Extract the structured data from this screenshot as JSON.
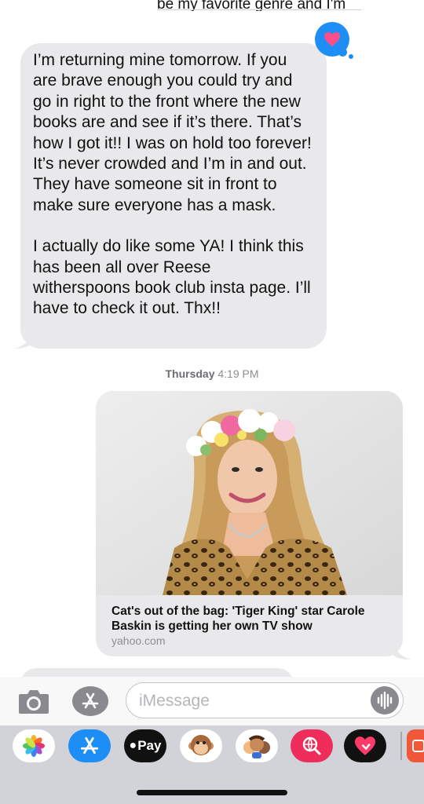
{
  "thread": {
    "previous_fragment": "be my favorite genre and I'm going",
    "incoming_message": {
      "paragraph1": "I’m returning mine tomorrow. If you are brave enough you could try and go in right to the front where the new books are and see if it’s there. That’s how I got it!! I was on hold too forever! It’s never crowded and I’m in and out. They have someone sit in front to make sure everyone has a mask.",
      "paragraph2": "I actually do like some YA! I think this has been all over  Reese witherspoons book club insta page. I’ll have to check it out. Thx!!"
    },
    "tapback": "heart-icon",
    "timestamp_day": "Thursday",
    "timestamp_time": "4:19 PM",
    "link_preview": {
      "title": "Cat's out of the bag: 'Tiger King' star Carole Baskin is getting her own TV show",
      "domain": "yahoo.com"
    }
  },
  "input_bar": {
    "placeholder": "iMessage"
  },
  "app_strip": {
    "items": [
      "photos-icon",
      "app-store-icon",
      "apple-pay-icon",
      "animoji-icon",
      "memoji-icon",
      "search-images-icon",
      "digital-touch-icon",
      "more-apps-icon"
    ],
    "apple_pay_label": "Pay"
  },
  "colors": {
    "incoming_bubble": "#e9e9eb",
    "imessage_blue": "#1e8ef5",
    "app_strip_bg": "#d1d3d9"
  }
}
